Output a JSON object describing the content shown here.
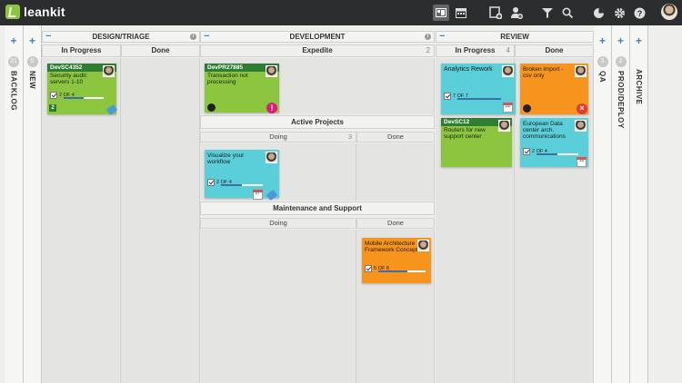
{
  "topbar": {
    "brand": "leankit",
    "icons": [
      "board-view-icon",
      "calendar-icon",
      "add-card-icon",
      "add-user-icon",
      "filter-icon",
      "search-icon",
      "activity-icon",
      "settings-icon",
      "help-icon",
      "user-avatar"
    ]
  },
  "lanes": {
    "backlog": {
      "title": "BACKLOG",
      "count": "31"
    },
    "new": {
      "title": "NEW",
      "count": "0"
    },
    "design": {
      "title": "DESIGN/TRIAGE",
      "in_progress": "In Progress",
      "done": "Done"
    },
    "development": {
      "title": "DEVELOPMENT",
      "expedite": "Expedite",
      "expedite_count": "2",
      "active": "Active Projects",
      "active_doing": "Doing",
      "active_doing_count": "3",
      "active_done": "Done",
      "maint": "Maintenance and Support",
      "maint_doing": "Doing",
      "maint_done": "Done"
    },
    "review": {
      "title": "REVIEW",
      "in_progress": "In Progress",
      "in_progress_count": "4",
      "done": "Done"
    },
    "qa": {
      "title": "QA",
      "count": "3"
    },
    "prod": {
      "title": "PROD/DEPLOY",
      "count": "2"
    },
    "archive": {
      "title": "ARCHIVE"
    }
  },
  "cards": {
    "c1": {
      "id": "DevSC4352",
      "title": "Security audit: servers 1-10",
      "progress": "2 OF 4",
      "progress_fraction": 0.5,
      "count": "2",
      "color": "#8cc63f"
    },
    "c2": {
      "id": "DevPR27885",
      "title": "Transaction not processing",
      "color": "#8cc63f"
    },
    "c3": {
      "title": "Visualize your workflow",
      "progress": "2 OF 4",
      "progress_fraction": 0.5,
      "date": "27",
      "color": "#5bcfd9"
    },
    "c4": {
      "title": "Mobile Architecture Framework Concept",
      "progress": "5 OF 8",
      "progress_fraction": 0.625,
      "color": "#f7941e"
    },
    "c5": {
      "title": "Analytics Rework",
      "progress": "7 OF 7",
      "progress_fraction": 1.0,
      "date": "22",
      "color": "#5bcfd9"
    },
    "c6": {
      "id": "DevSC12",
      "title": "Routers for new support center",
      "color": "#8cc63f"
    },
    "c7": {
      "title": "Broken import - csv only",
      "color": "#f7941e"
    },
    "c8": {
      "title": "European Data center arch. communications",
      "progress": "2 OF 4",
      "progress_fraction": 0.5,
      "date": "16",
      "color": "#5bcfd9"
    }
  }
}
